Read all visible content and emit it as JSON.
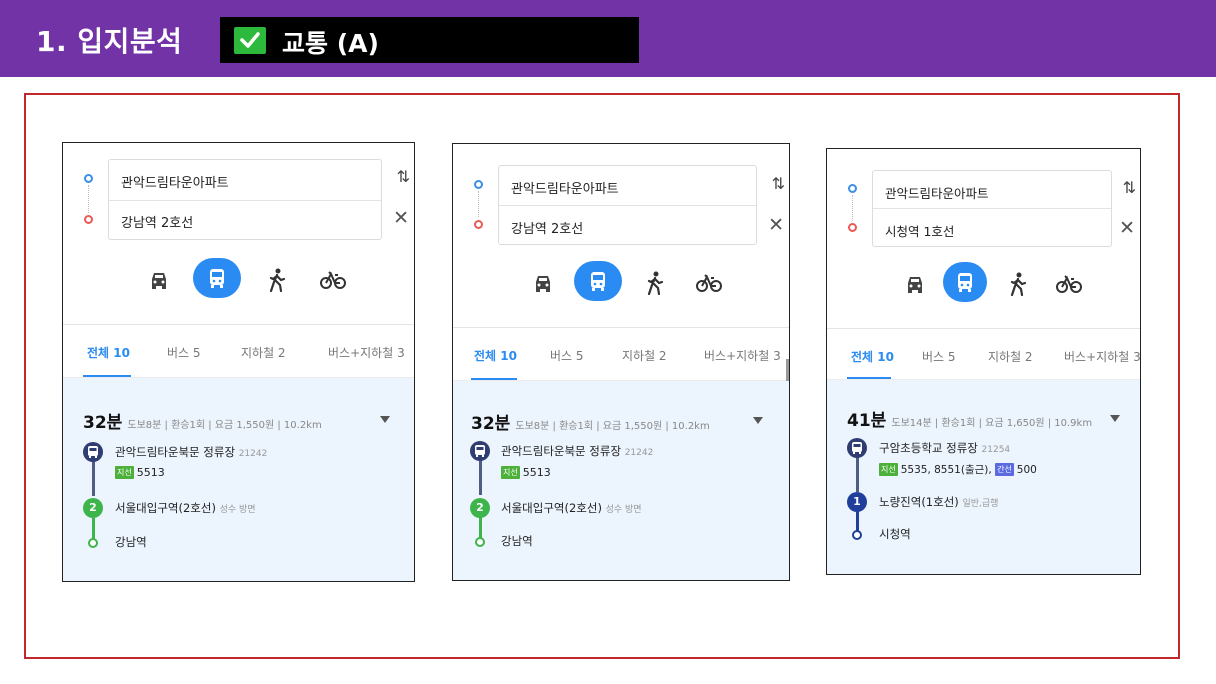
{
  "header": {
    "title": "1. 입지분석",
    "tag": "교통 (A)",
    "colors": {
      "bar": "#7233a7",
      "tag_bg": "#000000",
      "check": "#2dba3c"
    }
  },
  "cards": [
    {
      "origin": "관악드림타운아파트",
      "destination": "강남역 2호선",
      "tabs": [
        "전체 10",
        "버스 5",
        "지하철 2",
        "버스+지하철 3"
      ],
      "result": {
        "time": "32분",
        "info": "도보8분 | 환승1회 | 요금 1,550원 | 10.2km",
        "step1_name": "관악드림타운북문 정류장",
        "step1_id": "21242",
        "bus_badge": "지선",
        "bus_number": "5513",
        "step2_icon": "2",
        "step2_name": "서울대입구역(2호선)",
        "step2_dir": "성수 방면",
        "end_name": "강남역"
      }
    },
    {
      "origin": "관악드림타운아파트",
      "destination": "강남역 2호선",
      "tabs": [
        "전체 10",
        "버스 5",
        "지하철 2",
        "버스+지하철 3"
      ],
      "result": {
        "time": "32분",
        "info": "도보8분 | 환승1회 | 요금 1,550원 | 10.2km",
        "step1_name": "관악드림타운북문 정류장",
        "step1_id": "21242",
        "bus_badge": "지선",
        "bus_number": "5513",
        "step2_icon": "2",
        "step2_name": "서울대입구역(2호선)",
        "step2_dir": "성수 방면",
        "end_name": "강남역"
      }
    },
    {
      "origin": "관악드림타운아파트",
      "destination": "시청역 1호선",
      "tabs": [
        "전체 10",
        "버스 5",
        "지하철 2",
        "버스+지하철 3"
      ],
      "result": {
        "time": "41분",
        "info": "도보14분 | 환승1회 | 요금 1,650원 | 10.9km",
        "step1_name": "구암초등학교 정류장",
        "step1_id": "21254",
        "bus_badge": "지선",
        "bus_number": "5535, 8551(출근),",
        "bus_badge2": "간선",
        "bus_number2": "500",
        "step2_icon": "1",
        "step2_name": "노량진역(1호선)",
        "step2_dir": "일반,급행",
        "end_name": "시청역"
      }
    }
  ],
  "icons": [
    "check-icon",
    "swap-icon",
    "close-icon",
    "car-icon",
    "bus-icon",
    "walk-icon",
    "bike-icon",
    "dropdown-caret-icon"
  ],
  "colors": {
    "accent": "#2a8bf2",
    "line2": "#3db54a",
    "line1": "#1f3f9a",
    "bus_stop": "#2f3d72",
    "frame": "#c0282c"
  }
}
